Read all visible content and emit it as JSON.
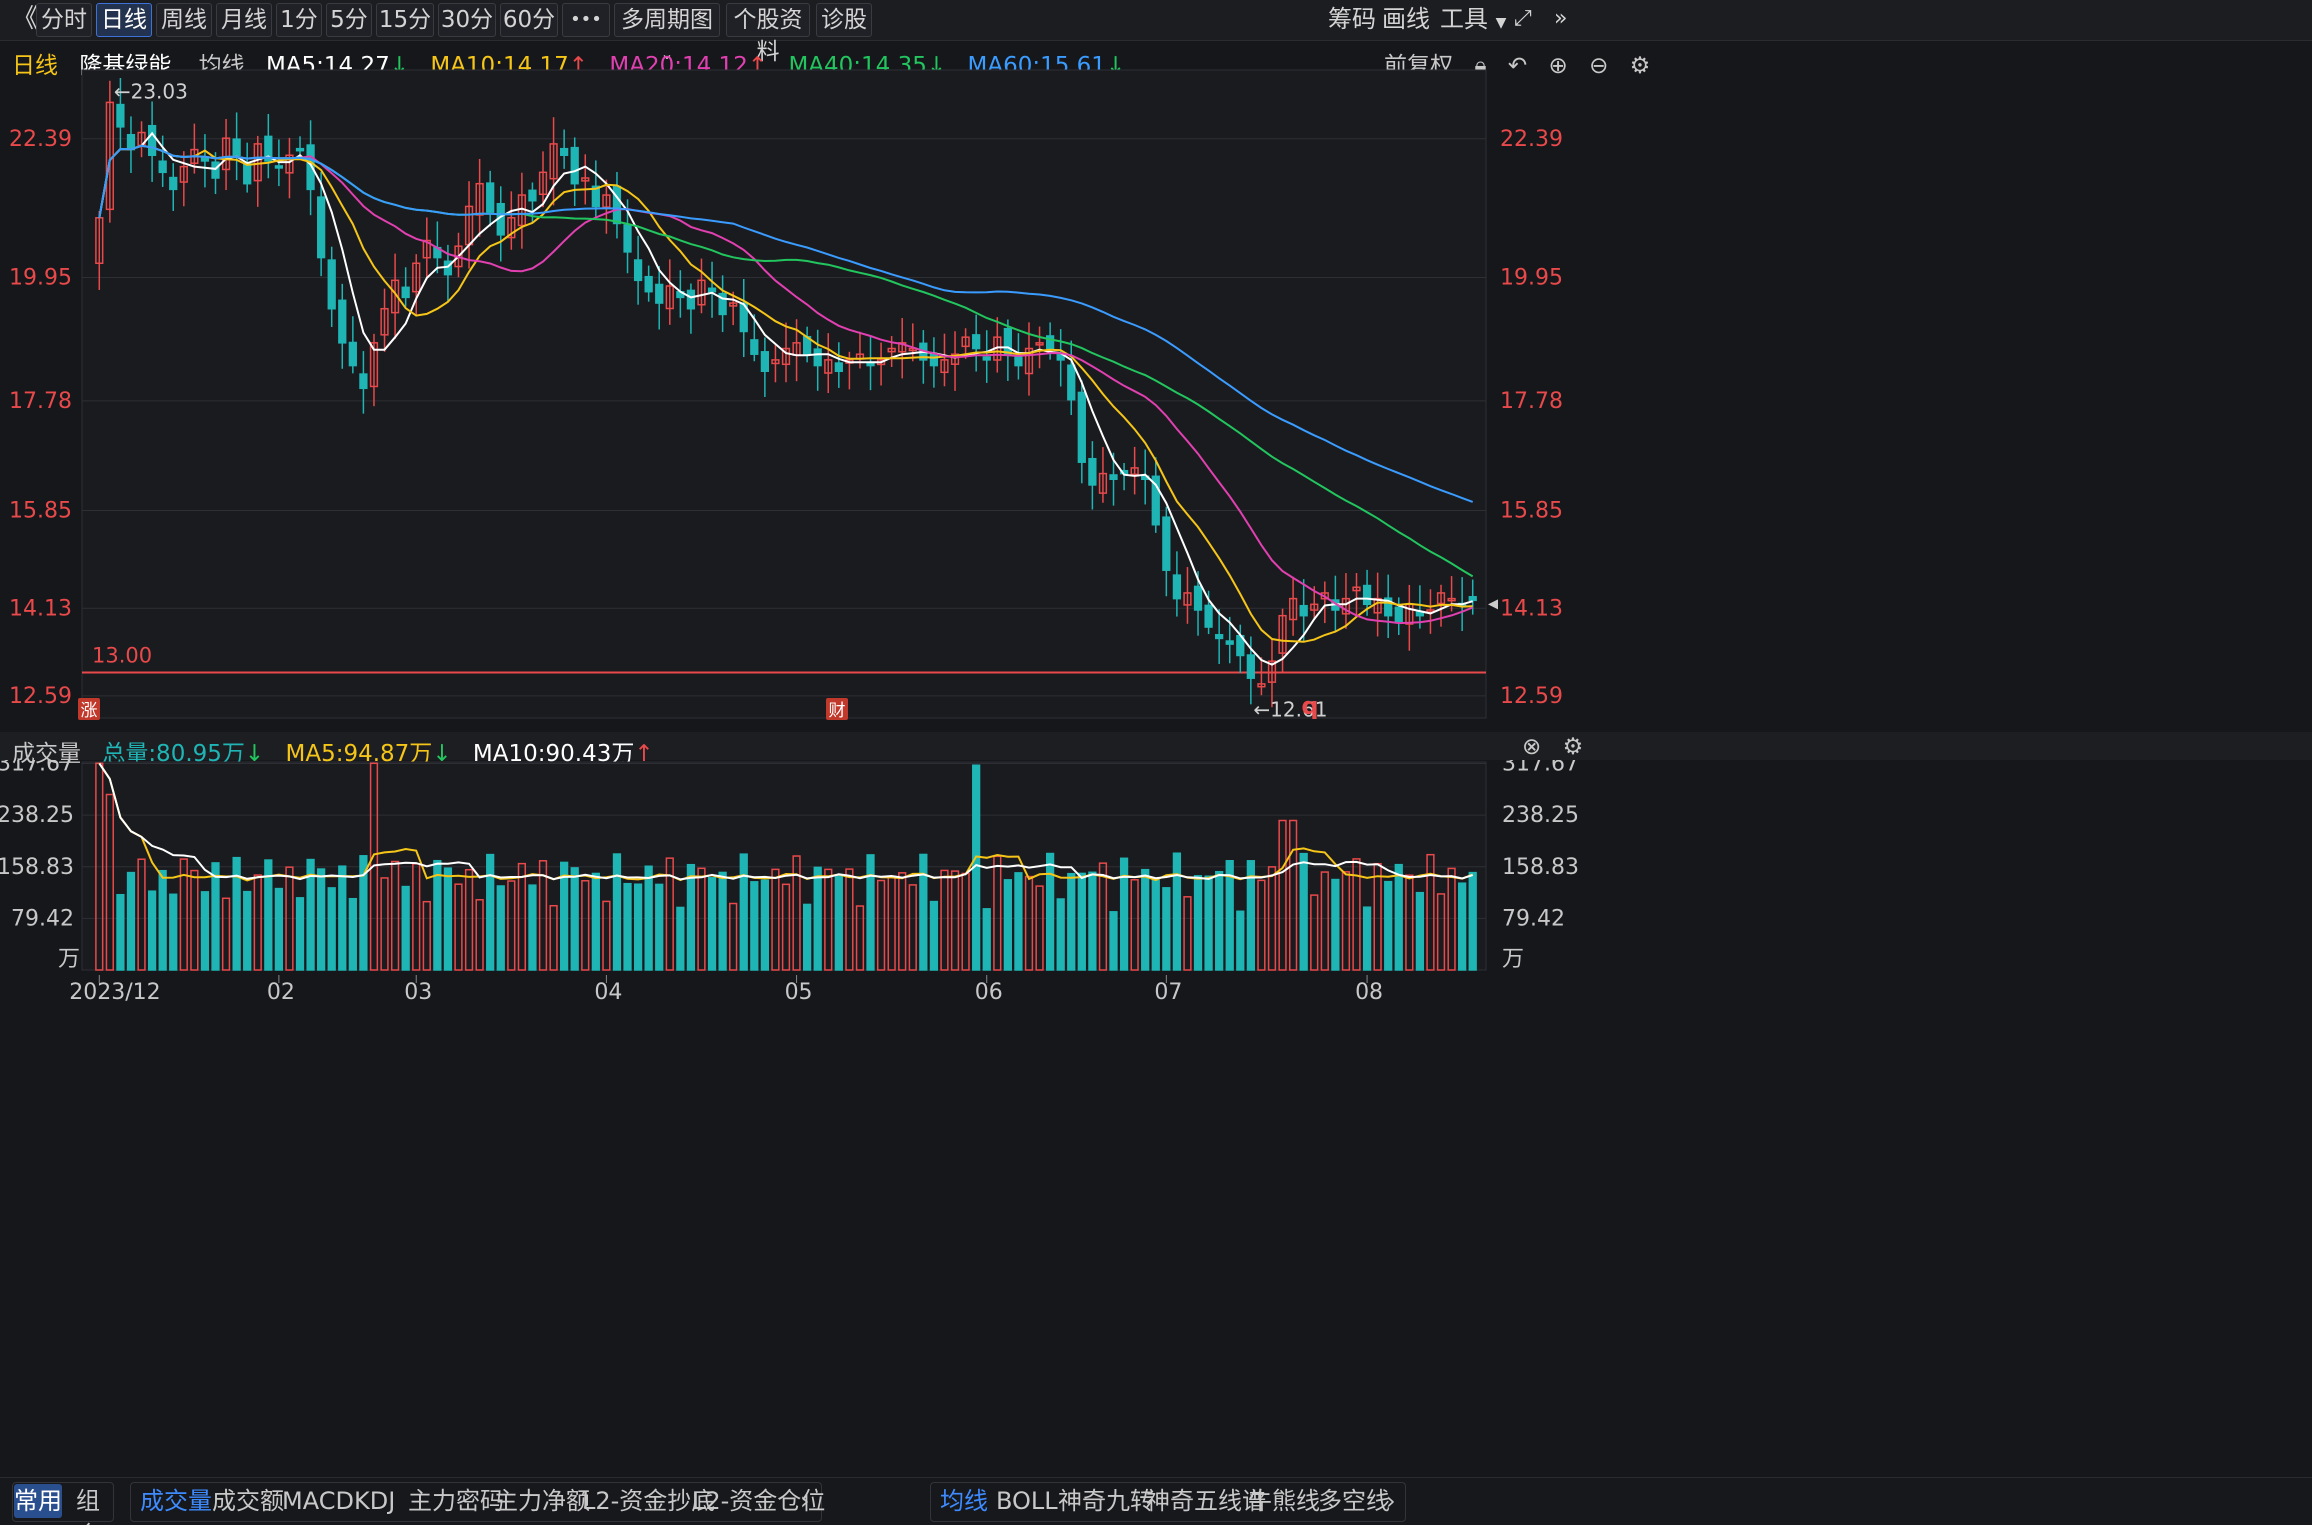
{
  "toolbar": {
    "back_icon": "double-chevron-left",
    "periods": [
      "分时",
      "日线",
      "周线",
      "月线",
      "1分",
      "5分",
      "15分",
      "30分",
      "60分"
    ],
    "active_period": "日线",
    "more_label": "•••",
    "multi_period_label": "多周期图",
    "stock_info_label": "个股资料",
    "diagnose_label": "诊股",
    "chips_label": "筹码",
    "draw_label": "画线",
    "tools_label": "工具",
    "fullscreen_icon": "expand-icon"
  },
  "header": {
    "period_label": "日线",
    "stock_name": "隆基绿能",
    "ma_label": "均线",
    "ma": [
      {
        "label": "MA5:14.27",
        "color": "#ffffff",
        "dir": "down"
      },
      {
        "label": "MA10:14.17",
        "color": "#f5c518",
        "dir": "up"
      },
      {
        "label": "MA20:14.12",
        "color": "#e040b0",
        "dir": "up"
      },
      {
        "label": "MA40:14.35",
        "color": "#22c55e",
        "dir": "down"
      },
      {
        "label": "MA60:15.61",
        "color": "#3b9cff",
        "dir": "down"
      }
    ],
    "adjust_label": "前复权"
  },
  "price_axis": {
    "ticks": [
      "22.39",
      "19.95",
      "17.78",
      "15.85",
      "14.13",
      "12.59"
    ],
    "high_mark": "←23.03",
    "low_mark": "←12.61",
    "line_label": "13.00",
    "marker_zhang": "涨",
    "marker_cai": "财",
    "marker_q": "q"
  },
  "volume": {
    "title": "成交量",
    "total": "总量:80.95万",
    "ma5": "MA5:94.87万",
    "ma10": "MA10:90.43万",
    "ticks": [
      "317.67",
      "238.25",
      "158.83",
      "79.42"
    ],
    "unit": "万"
  },
  "date_axis": [
    "2023/12",
    "02",
    "03",
    "04",
    "05",
    "06",
    "07",
    "08"
  ],
  "bottom": {
    "mode_tabs": [
      "常用",
      "组合"
    ],
    "indicator_tabs": [
      "成交量",
      "成交额",
      "MACD",
      "KDJ",
      "主力密码",
      "主力净额",
      "L2-资金抄底",
      "L2-资金仓位"
    ],
    "overlay_tabs": [
      "均线",
      "BOLL",
      "神奇九转",
      "神奇五线谱",
      "牛熊线",
      "多空线"
    ]
  },
  "colors": {
    "up": "#e8494a",
    "down": "#1fb5b5",
    "ma5": "#ffffff",
    "ma10": "#f5c518",
    "ma20": "#e040b0",
    "ma40": "#22c55e",
    "ma60": "#3b9cff",
    "accent": "#3d8bff"
  },
  "chart_data": {
    "type": "candlestick",
    "title": "隆基绿能",
    "price_range": [
      12.2,
      23.6
    ],
    "closes": [
      21.0,
      23.03,
      22.6,
      22.2,
      22.5,
      22.1,
      21.8,
      21.5,
      21.9,
      22.2,
      22.0,
      21.7,
      22.4,
      22.1,
      21.6,
      22.3,
      22.0,
      21.9,
      22.1,
      22.2,
      21.5,
      20.3,
      19.4,
      18.8,
      18.4,
      18.0,
      18.8,
      19.4,
      19.9,
      19.6,
      20.2,
      20.6,
      20.3,
      20.0,
      20.5,
      21.2,
      21.6,
      21.1,
      20.7,
      21.0,
      21.4,
      21.3,
      21.8,
      22.3,
      22.1,
      21.6,
      21.7,
      21.2,
      21.4,
      20.9,
      20.4,
      19.9,
      19.7,
      19.5,
      19.8,
      19.6,
      19.4,
      19.9,
      19.7,
      19.3,
      19.5,
      19.0,
      18.6,
      18.3,
      18.5,
      18.7,
      18.8,
      18.6,
      18.4,
      18.5,
      18.3,
      18.5,
      18.6,
      18.4,
      18.5,
      18.7,
      18.8,
      18.7,
      18.5,
      18.4,
      18.5,
      18.6,
      18.9,
      18.7,
      18.5,
      18.9,
      18.6,
      18.4,
      18.7,
      18.8,
      18.7,
      18.5,
      17.8,
      16.7,
      16.3,
      16.5,
      16.4,
      16.5,
      16.6,
      16.4,
      15.6,
      14.8,
      14.3,
      14.4,
      14.1,
      13.8,
      13.6,
      13.5,
      13.3,
      12.9,
      12.8,
      13.2,
      14.0,
      14.3,
      14.0,
      14.2,
      14.4,
      14.1,
      14.3,
      14.5,
      14.2,
      14.3,
      14.0,
      13.9,
      14.2,
      14.0,
      14.1,
      14.4,
      14.3,
      14.2,
      14.27
    ],
    "vol_range": [
      0,
      320
    ]
  }
}
